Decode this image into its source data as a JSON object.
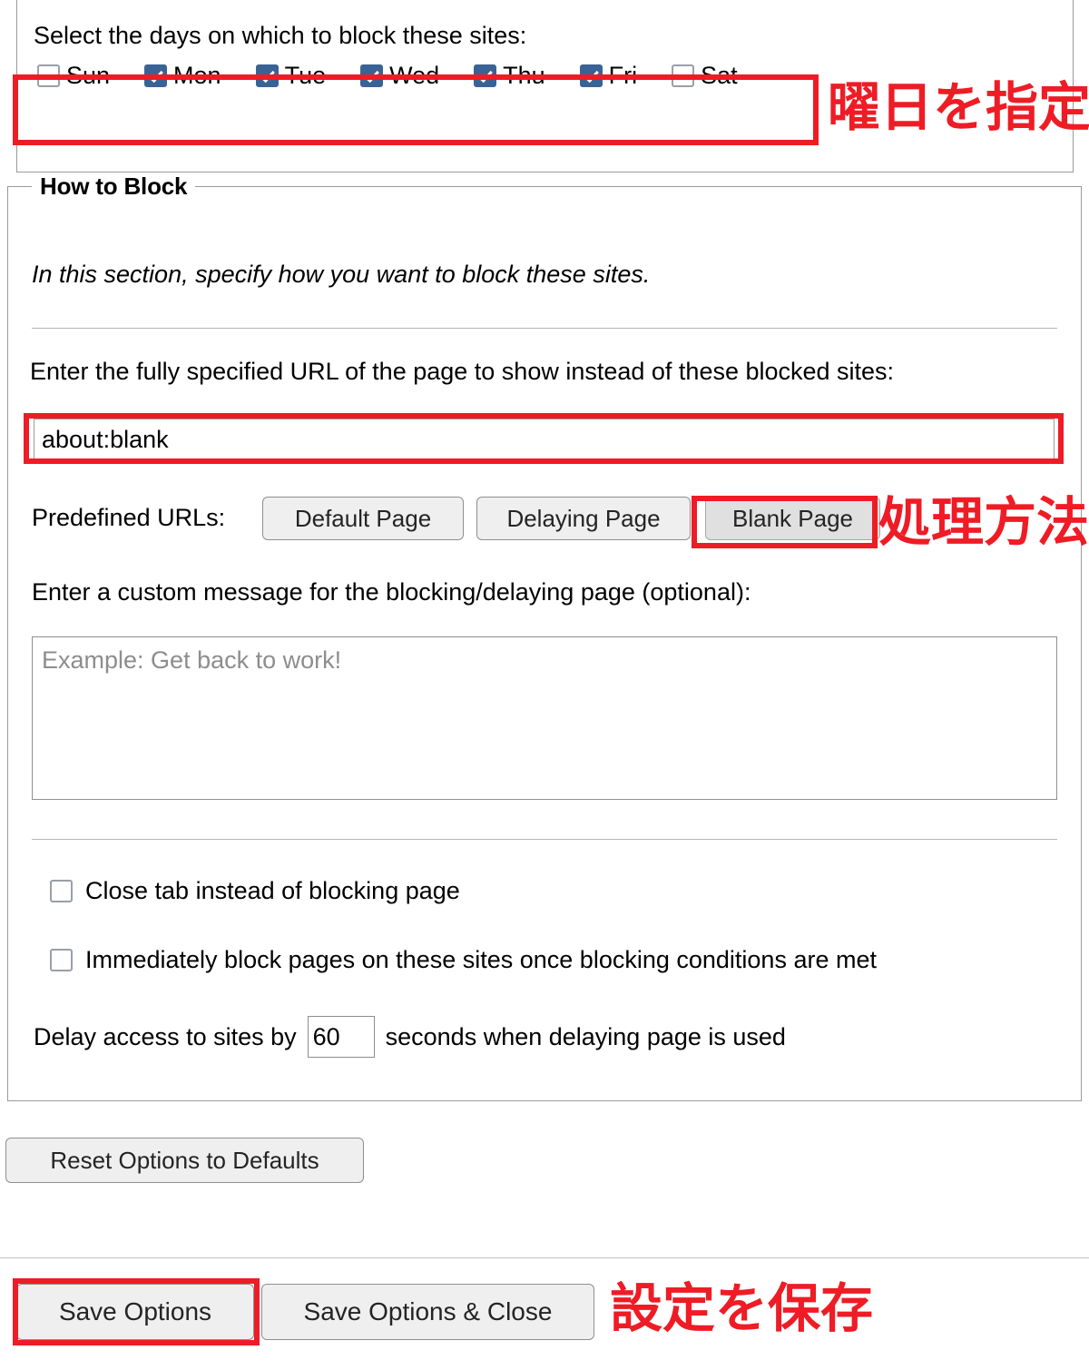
{
  "days_section": {
    "prompt": "Select the days on which to block these sites:",
    "days": [
      {
        "label": "Sun",
        "checked": false
      },
      {
        "label": "Mon",
        "checked": true
      },
      {
        "label": "Tue",
        "checked": true
      },
      {
        "label": "Wed",
        "checked": true
      },
      {
        "label": "Thu",
        "checked": true
      },
      {
        "label": "Fri",
        "checked": true
      },
      {
        "label": "Sat",
        "checked": false
      }
    ]
  },
  "how_to_block": {
    "legend": "How to Block",
    "intro_note": "In this section, specify how you want to block these sites.",
    "url_prompt": "Enter the fully specified URL of the page to show instead of these blocked sites:",
    "url_value": "about:blank",
    "predefined_label": "Predefined URLs:",
    "predefined_buttons": [
      "Default Page",
      "Delaying Page",
      "Blank Page"
    ],
    "custom_message_prompt": "Enter a custom message for the blocking/delaying page (optional):",
    "custom_message_value": "",
    "custom_message_placeholder": "Example: Get back to work!",
    "close_tab_option": {
      "label": "Close tab instead of blocking page",
      "checked": false
    },
    "immediate_block_option": {
      "label": "Immediately block pages on these sites once blocking conditions are met",
      "checked": false
    },
    "delay_row": {
      "prefix": "Delay access to sites by",
      "value": "60",
      "suffix": "seconds when delaying page is used"
    }
  },
  "reset_button": "Reset Options to Defaults",
  "footer": {
    "save": "Save Options",
    "save_and_close": "Save Options & Close"
  },
  "annotations": {
    "days": "曜日を指定",
    "method": "処理方法",
    "save": "設定を保存",
    "color": "#ee1c25"
  }
}
